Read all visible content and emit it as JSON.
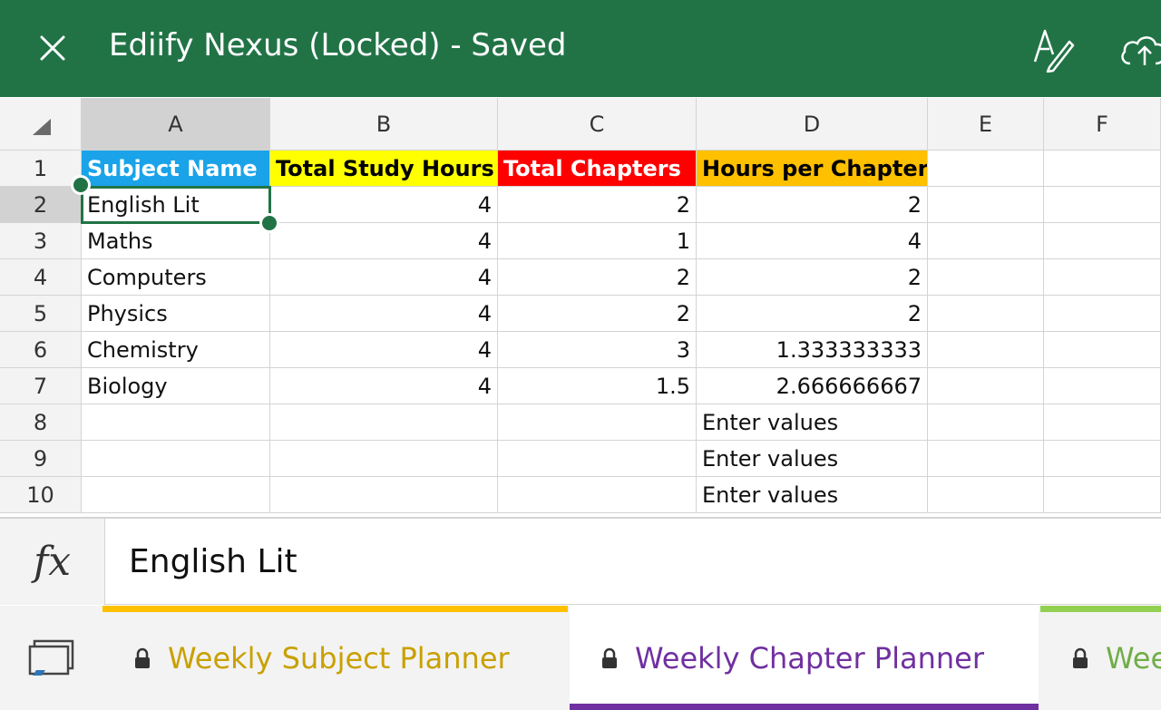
{
  "app": {
    "title": "Ediify Nexus (Locked) - Saved",
    "accent": "#217346"
  },
  "columns": [
    "A",
    "B",
    "C",
    "D",
    "E",
    "F"
  ],
  "rows": [
    "1",
    "2",
    "3",
    "4",
    "5",
    "6",
    "7",
    "8",
    "9",
    "10"
  ],
  "selected_cell": "A2",
  "header_row": [
    {
      "col": "A",
      "text": "Subject Name",
      "bg": "#1aa3e8",
      "color": "#ffffff"
    },
    {
      "col": "B",
      "text": "Total Study Hours",
      "bg": "#ffff00",
      "color": "#000000"
    },
    {
      "col": "C",
      "text": "Total Chapters",
      "bg": "#ff0000",
      "color": "#ffffff"
    },
    {
      "col": "D",
      "text": "Hours per Chapter",
      "bg": "#ffc000",
      "color": "#000000"
    }
  ],
  "data_rows": [
    {
      "A": "English Lit",
      "B": "4",
      "C": "2",
      "D": "2"
    },
    {
      "A": "Maths",
      "B": "4",
      "C": "1",
      "D": "4"
    },
    {
      "A": "Computers",
      "B": "4",
      "C": "2",
      "D": "2"
    },
    {
      "A": "Physics",
      "B": "4",
      "C": "2",
      "D": "2"
    },
    {
      "A": "Chemistry",
      "B": "4",
      "C": "3",
      "D": "1.333333333"
    },
    {
      "A": "Biology",
      "B": "4",
      "C": "1.5",
      "D": "2.666666667"
    },
    {
      "A": "",
      "B": "",
      "C": "",
      "D": "Enter values"
    },
    {
      "A": "",
      "B": "",
      "C": "",
      "D": "Enter values"
    },
    {
      "A": "",
      "B": "",
      "C": "",
      "D": "Enter values"
    }
  ],
  "formula_bar": {
    "icon": "fx",
    "value": "English Lit"
  },
  "sheet_tabs": [
    {
      "label": "Weekly Subject Planner",
      "color": "#c9a000",
      "strip": "#ffc000",
      "active": false
    },
    {
      "label": "Weekly Chapter Planner",
      "color": "#7030a0",
      "strip": "#7030a0",
      "active": true
    },
    {
      "label": "Wee",
      "color": "#70ad47",
      "strip": "#92d050",
      "active": false
    }
  ],
  "icons": {
    "close": "close-icon",
    "pen": "pen-icon",
    "cloud": "cloud-upload-icon",
    "lock": "lock-icon",
    "sheets": "sheet-list-icon",
    "select_all": "select-all-icon"
  }
}
